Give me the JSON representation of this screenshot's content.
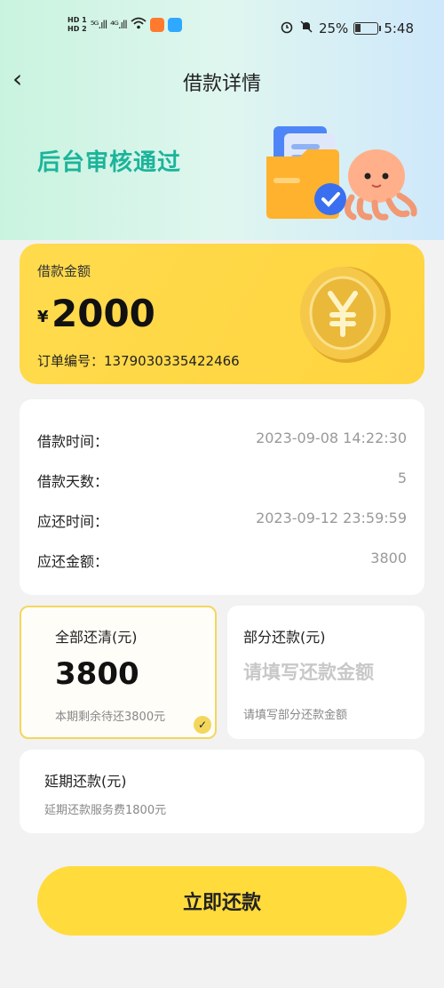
{
  "status_bar": {
    "hd1": "HD 1",
    "hd2": "HD 2",
    "signal1": "⁵ᴳ.ıll",
    "signal2": "⁴ᴳ.ıll",
    "battery": "25%",
    "time": "5:48"
  },
  "nav": {
    "back_icon": "‹",
    "title": "借款详情"
  },
  "hero": {
    "title": "后台审核通过"
  },
  "loan": {
    "label": "借款金额",
    "currency": "¥",
    "amount": "2000",
    "order": "订单编号：1379030335422466"
  },
  "info": [
    {
      "key": "借款时间：",
      "value": "2023-09-08 14:22:30"
    },
    {
      "key": "借款天数：",
      "value": "5"
    },
    {
      "key": "应还时间：",
      "value": "2023-09-12 23:59:59"
    },
    {
      "key": "应还金额：",
      "value": "3800"
    }
  ],
  "pay_full": {
    "title": "全部还清(元)",
    "amount": "3800",
    "sub": "本期剩余待还3800元",
    "checked": true
  },
  "pay_part": {
    "title": "部分还款(元)",
    "placeholder": "请填写还款金额",
    "sub": "请填写部分还款金额"
  },
  "pay_defer": {
    "title": "延期还款(元)",
    "sub": "延期还款服务费1800元"
  },
  "submit_label": "立即还款",
  "colors": {
    "accent": "#ffdb3c",
    "hero_green": "#1bb49a"
  }
}
